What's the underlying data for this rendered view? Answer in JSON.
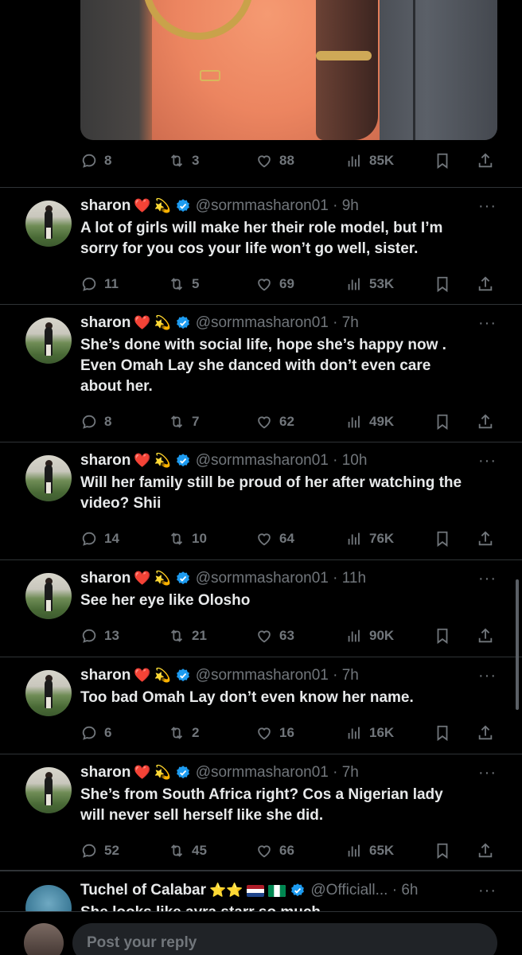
{
  "top_post": {
    "stats": {
      "replies": "8",
      "reposts": "3",
      "likes": "88",
      "views": "85K"
    }
  },
  "tweets": [
    {
      "name": "sharon",
      "emoji1": "❤️",
      "emoji2": "💫",
      "handle": "@sormmasharon01 · 9h",
      "lines": [
        "A lot of girls will make her their role model, but I’m",
        "sorry for you cos your life won’t go well, sister."
      ],
      "stats": {
        "replies": "11",
        "reposts": "5",
        "likes": "69",
        "views": "53K"
      }
    },
    {
      "name": "sharon",
      "emoji1": "❤️",
      "emoji2": "💫",
      "handle": "@sormmasharon01 · 7h",
      "lines": [
        "She’s done with social life, hope she’s happy now .",
        "Even Omah Lay she danced with don’t even care",
        "about her."
      ],
      "stats": {
        "replies": "8",
        "reposts": "7",
        "likes": "62",
        "views": "49K"
      }
    },
    {
      "name": "sharon",
      "emoji1": "❤️",
      "emoji2": "💫",
      "handle": "@sormmasharon01 · 10h",
      "lines": [
        "Will her family still be proud of her after watching the",
        "video? Shii"
      ],
      "stats": {
        "replies": "14",
        "reposts": "10",
        "likes": "64",
        "views": "76K"
      }
    },
    {
      "name": "sharon",
      "emoji1": "❤️",
      "emoji2": "💫",
      "handle": "@sormmasharon01 · 11h",
      "lines": [
        "See her eye like Olosho"
      ],
      "stats": {
        "replies": "13",
        "reposts": "21",
        "likes": "63",
        "views": "90K"
      }
    },
    {
      "name": "sharon",
      "emoji1": "❤️",
      "emoji2": "💫",
      "handle": "@sormmasharon01 · 7h",
      "lines": [
        "Too bad Omah Lay don’t even know her name."
      ],
      "stats": {
        "replies": "6",
        "reposts": "2",
        "likes": "16",
        "views": "16K"
      }
    },
    {
      "name": "sharon",
      "emoji1": "❤️",
      "emoji2": "💫",
      "handle": "@sormmasharon01 · 7h",
      "lines": [
        "She’s from South Africa right? Cos a Nigerian  lady",
        "will never sell herself like she did."
      ],
      "stats": {
        "replies": "52",
        "reposts": "45",
        "likes": "66",
        "views": "65K"
      }
    }
  ],
  "last_tweet": {
    "name": "Tuchel of Calabar",
    "stars": "⭐⭐",
    "handle": "@Officiall... · 6h",
    "partial_line": "She looks like ayra starr so much"
  },
  "reply_bar": {
    "placeholder": "Post your reply"
  },
  "more_label": "···",
  "colors": {
    "background": "#000000",
    "text": "#e7e9ea",
    "muted": "#71767b",
    "verified": "#1d9bf0",
    "divider": "#2f3336"
  }
}
